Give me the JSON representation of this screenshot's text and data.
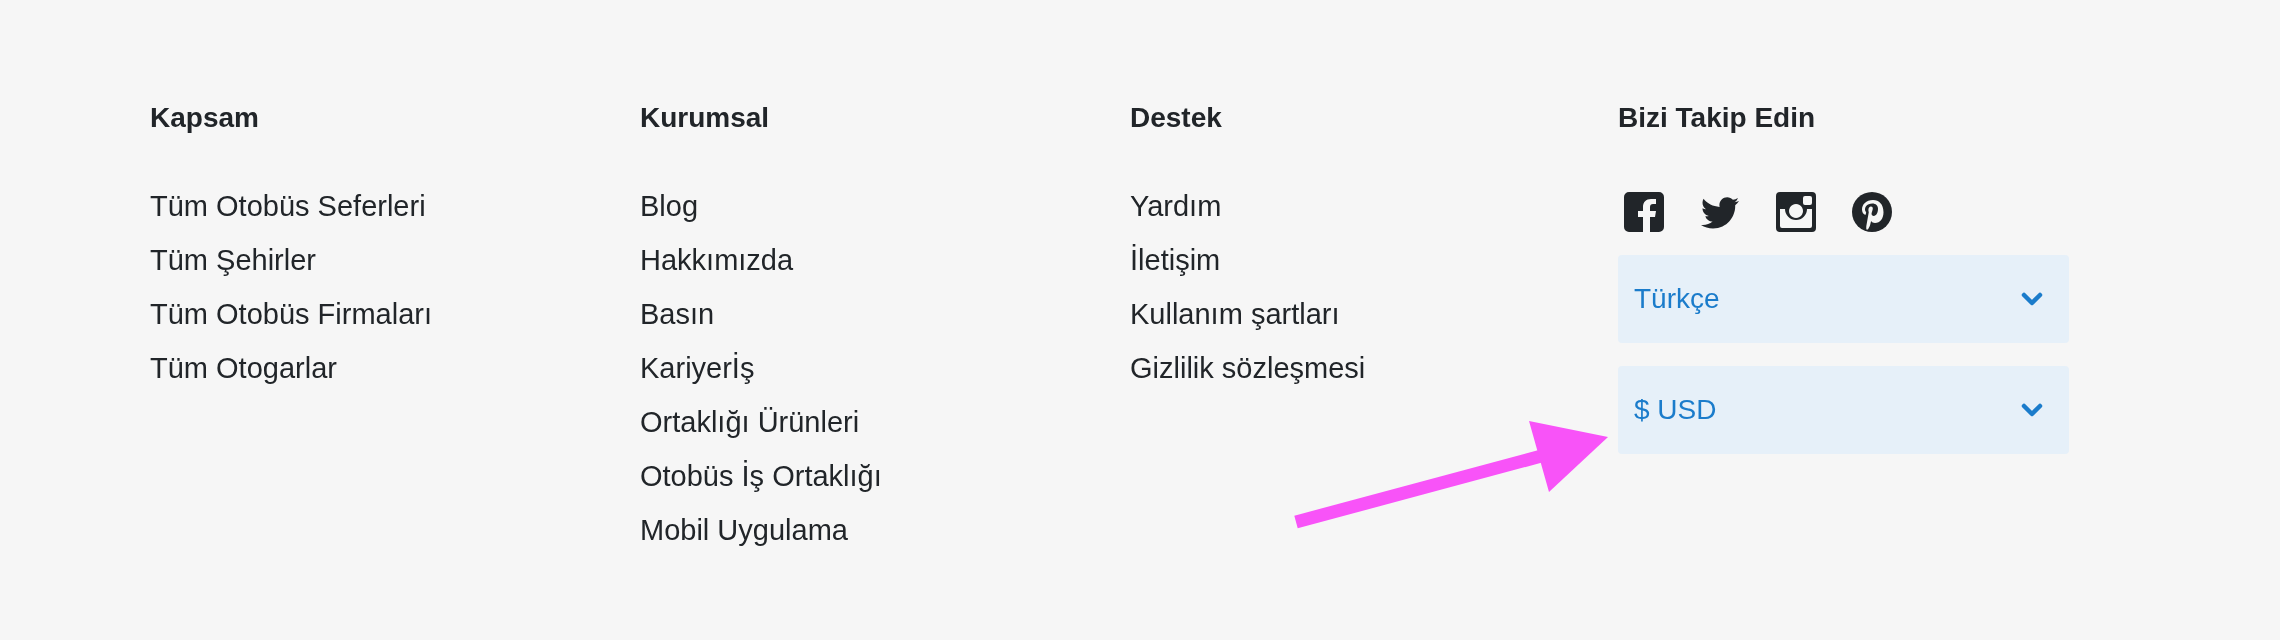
{
  "columns": [
    {
      "heading": "Kapsam",
      "links": [
        "Tüm Otobüs Seferleri",
        "Tüm Şehirler",
        "Tüm Otobüs Firmaları",
        "Tüm Otogarlar"
      ]
    },
    {
      "heading": "Kurumsal",
      "links": [
        "Blog",
        "Hakkımızda",
        "Basın",
        "Kariyerİş",
        "Ortaklığı Ürünleri",
        "Otobüs İş Ortaklığı",
        "Mobil Uygulama"
      ]
    },
    {
      "heading": "Destek",
      "links": [
        "Yardım",
        "İletişim",
        "Kullanım şartları",
        "Gizlilik sözleşmesi"
      ]
    }
  ],
  "follow": {
    "heading": "Bizi Takip Edin",
    "dropdowns": [
      {
        "value": "Türkçe"
      },
      {
        "value": "$ USD"
      }
    ]
  }
}
